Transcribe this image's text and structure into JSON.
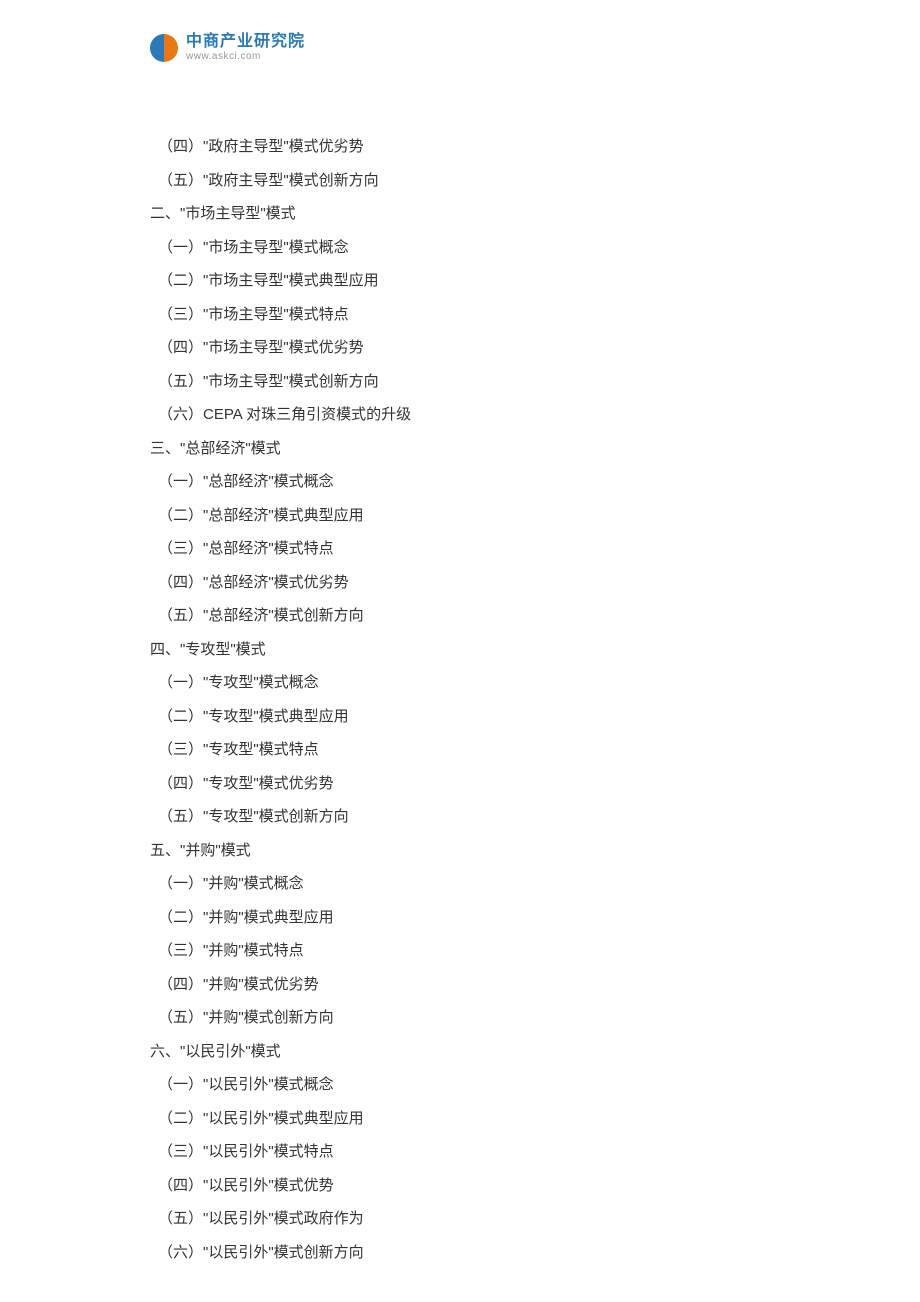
{
  "logo": {
    "cn": "中商产业研究院",
    "url": "www.askci.com"
  },
  "lines": [
    {
      "text": "（四）\"政府主导型\"模式优劣势",
      "sub": true
    },
    {
      "text": "（五）\"政府主导型\"模式创新方向",
      "sub": true
    },
    {
      "text": "二、\"市场主导型\"模式",
      "sub": false
    },
    {
      "text": "（一）\"市场主导型\"模式概念",
      "sub": true
    },
    {
      "text": "（二）\"市场主导型\"模式典型应用",
      "sub": true
    },
    {
      "text": "（三）\"市场主导型\"模式特点",
      "sub": true
    },
    {
      "text": "（四）\"市场主导型\"模式优劣势",
      "sub": true
    },
    {
      "text": "（五）\"市场主导型\"模式创新方向",
      "sub": true
    },
    {
      "text": "（六）CEPA 对珠三角引资模式的升级",
      "sub": true
    },
    {
      "text": "三、\"总部经济\"模式",
      "sub": false
    },
    {
      "text": "（一）\"总部经济\"模式概念",
      "sub": true
    },
    {
      "text": "（二）\"总部经济\"模式典型应用",
      "sub": true
    },
    {
      "text": "（三）\"总部经济\"模式特点",
      "sub": true
    },
    {
      "text": "（四）\"总部经济\"模式优劣势",
      "sub": true
    },
    {
      "text": "（五）\"总部经济\"模式创新方向",
      "sub": true
    },
    {
      "text": "四、\"专攻型\"模式",
      "sub": false
    },
    {
      "text": "（一）\"专攻型\"模式概念",
      "sub": true
    },
    {
      "text": "（二）\"专攻型\"模式典型应用",
      "sub": true
    },
    {
      "text": "（三）\"专攻型\"模式特点",
      "sub": true
    },
    {
      "text": "（四）\"专攻型\"模式优劣势",
      "sub": true
    },
    {
      "text": "（五）\"专攻型\"模式创新方向",
      "sub": true
    },
    {
      "text": "五、\"并购\"模式",
      "sub": false
    },
    {
      "text": "（一）\"并购\"模式概念",
      "sub": true
    },
    {
      "text": "（二）\"并购\"模式典型应用",
      "sub": true
    },
    {
      "text": "（三）\"并购\"模式特点",
      "sub": true
    },
    {
      "text": "（四）\"并购\"模式优劣势",
      "sub": true
    },
    {
      "text": "（五）\"并购\"模式创新方向",
      "sub": true
    },
    {
      "text": "六、\"以民引外\"模式",
      "sub": false
    },
    {
      "text": "（一）\"以民引外\"模式概念",
      "sub": true
    },
    {
      "text": "（二）\"以民引外\"模式典型应用",
      "sub": true
    },
    {
      "text": "（三）\"以民引外\"模式特点",
      "sub": true
    },
    {
      "text": "（四）\"以民引外\"模式优势",
      "sub": true
    },
    {
      "text": "（五）\"以民引外\"模式政府作为",
      "sub": true
    },
    {
      "text": "（六）\"以民引外\"模式创新方向",
      "sub": true
    }
  ]
}
